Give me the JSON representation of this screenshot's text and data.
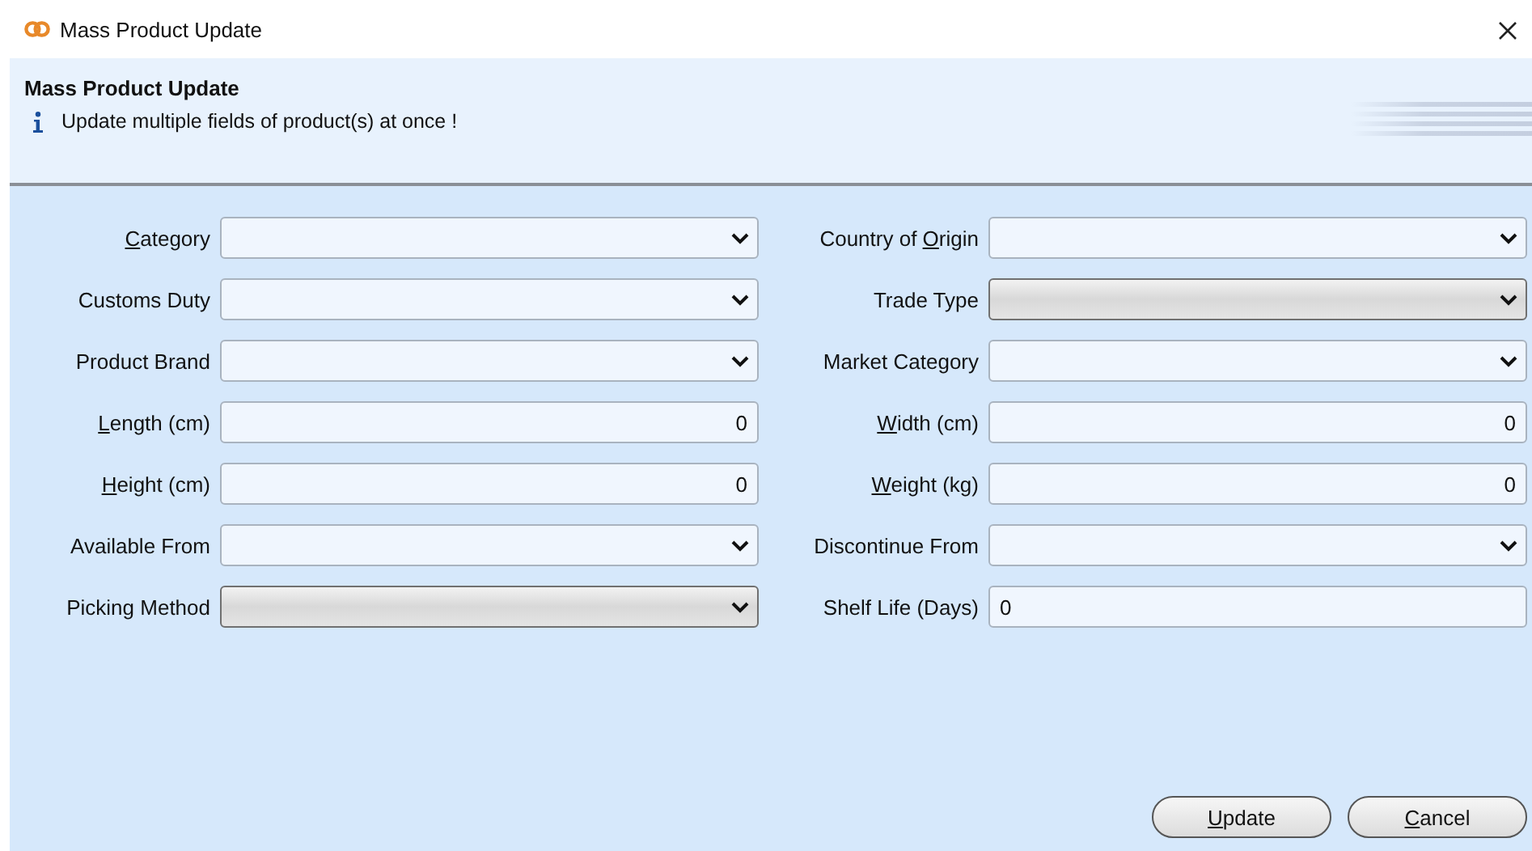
{
  "window": {
    "title": "Mass Product Update"
  },
  "header": {
    "title": "Mass Product Update",
    "message": "Update multiple fields of product(s) at once !"
  },
  "fields": [
    {
      "access_key": "C",
      "label_post": "ategory",
      "kind": "dropdown",
      "disabled": false
    },
    {
      "label_pre": "Country of ",
      "access_key": "O",
      "label_post": "rigin",
      "kind": "dropdown",
      "disabled": false
    },
    {
      "label_pre": "Customs Duty",
      "kind": "dropdown",
      "disabled": false
    },
    {
      "label_pre": "Trade Type",
      "kind": "dropdown",
      "disabled": true
    },
    {
      "label_pre": "Product Brand",
      "kind": "dropdown",
      "disabled": false
    },
    {
      "label_pre": "Market Category",
      "kind": "dropdown",
      "disabled": false
    },
    {
      "access_key": "L",
      "label_post": "ength (cm)",
      "kind": "number",
      "value": "0",
      "disabled": false
    },
    {
      "access_key": "W",
      "label_post": "idth (cm)",
      "kind": "number",
      "value": "0",
      "disabled": false
    },
    {
      "access_key": "H",
      "label_post": "eight (cm)",
      "kind": "number",
      "value": "0",
      "disabled": false
    },
    {
      "access_key": "W",
      "label_post": "eight (kg)",
      "kind": "number",
      "value": "0",
      "disabled": false
    },
    {
      "label_pre": "Available From",
      "kind": "dropdown",
      "disabled": false
    },
    {
      "label_pre": "Discontinue From",
      "kind": "dropdown",
      "disabled": false
    },
    {
      "label_pre": "Picking Method",
      "kind": "dropdown",
      "disabled": true
    },
    {
      "label_pre": "Shelf Life (Days)",
      "kind": "text",
      "value": "0",
      "disabled": false
    }
  ],
  "buttons": [
    {
      "access_key": "U",
      "label_post": "pdate"
    },
    {
      "access_key": "C",
      "label_post": "ancel"
    }
  ]
}
